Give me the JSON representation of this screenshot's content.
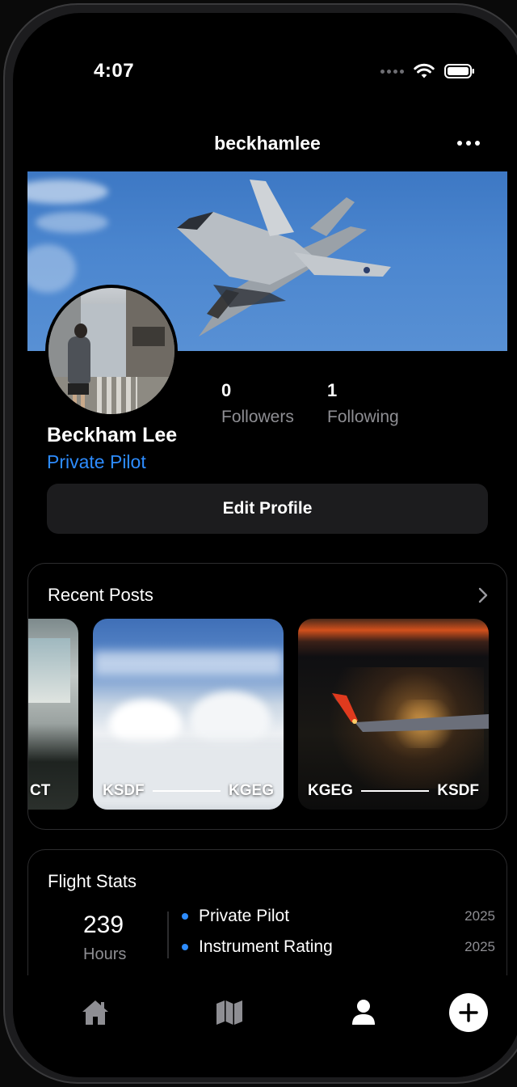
{
  "status_bar": {
    "time": "4:07"
  },
  "header": {
    "username": "beckhamlee"
  },
  "profile": {
    "name": "Beckham Lee",
    "title": "Private Pilot",
    "followers_count": "0",
    "followers_label": "Followers",
    "following_count": "1",
    "following_label": "Following",
    "edit_button": "Edit Profile"
  },
  "recent_posts": {
    "title": "Recent Posts",
    "posts": [
      {
        "origin": "",
        "destination": "CT"
      },
      {
        "origin": "KSDF",
        "destination": "KGEG"
      },
      {
        "origin": "KGEG",
        "destination": "KSDF"
      }
    ]
  },
  "flight_stats": {
    "title": "Flight Stats",
    "hours_value": "239",
    "hours_label": "Hours",
    "certificates": [
      {
        "label": "Private Pilot",
        "year": "2025"
      },
      {
        "label": "Instrument Rating",
        "year": "2025"
      }
    ]
  },
  "tabbar": {
    "items": [
      "home-icon",
      "map-icon",
      "profile-icon",
      "add-icon"
    ]
  },
  "colors": {
    "accent": "#2d8cff",
    "background": "#000000",
    "card_border": "#2c2c2e",
    "button_bg": "#1c1c1e"
  }
}
